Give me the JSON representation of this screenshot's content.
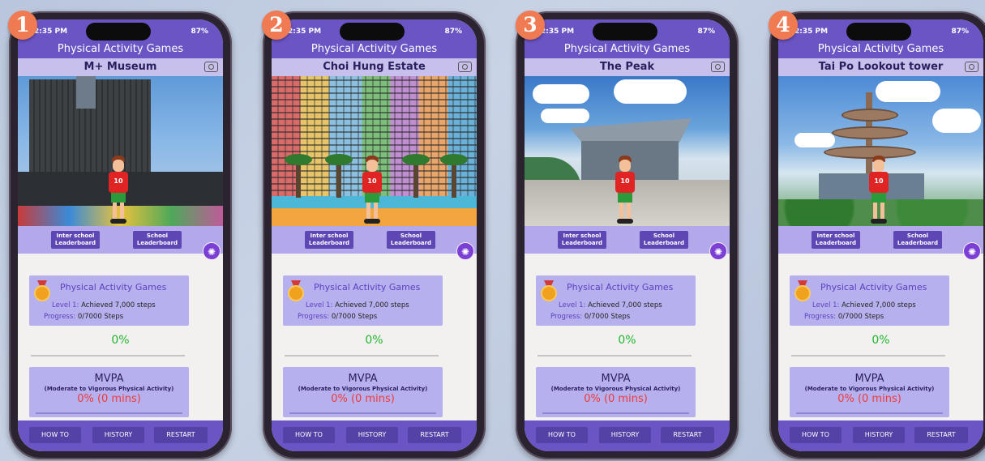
{
  "phones": [
    {
      "badge": "1",
      "status": {
        "time": "2:35 PM",
        "battery": "87%"
      },
      "app_title": "Physical Activity Games",
      "location": "M+ Museum",
      "jersey": "10",
      "inter_school": "Inter school\nLeaderboard",
      "school": "School\nLeaderboard",
      "card": {
        "title": "Physical Activity Games",
        "level_key": "Level 1:",
        "level_val": " Achieved 7,000 steps",
        "progress_key": "Progress:",
        "progress_val": " 0/7000 Steps"
      },
      "percent": "0%",
      "mvpa": {
        "title": "MVPA",
        "subtitle": "(Moderate to Vigorous Physical Activity)",
        "value": "0% (0 mins)"
      },
      "buttons": {
        "howto": "HOW TO",
        "history": "HISTORY",
        "restart": "RESTART"
      }
    },
    {
      "badge": "2",
      "status": {
        "time": "2:35 PM",
        "battery": "87%"
      },
      "app_title": "Physical Activity Games",
      "location": "Choi Hung Estate",
      "jersey": "10",
      "inter_school": "Inter school\nLeaderboard",
      "school": "School\nLeaderboard",
      "card": {
        "title": "Physical Activity Games",
        "level_key": "Level 1:",
        "level_val": " Achieved 7,000 steps",
        "progress_key": "Progress:",
        "progress_val": " 0/7000 Steps"
      },
      "percent": "0%",
      "mvpa": {
        "title": "MVPA",
        "subtitle": "(Moderate to Vigorous Physical Activity)",
        "value": "0% (0 mins)"
      },
      "buttons": {
        "howto": "HOW TO",
        "history": "HISTORY",
        "restart": "RESTART"
      }
    },
    {
      "badge": "3",
      "status": {
        "time": "2:35 PM",
        "battery": "87%"
      },
      "app_title": "Physical Activity Games",
      "location": "The Peak",
      "jersey": "10",
      "inter_school": "Inter school\nLeaderboard",
      "school": "School\nLeaderboard",
      "card": {
        "title": "Physical Activity Games",
        "level_key": "Level 1:",
        "level_val": " Achieved 7,000 steps",
        "progress_key": "Progress:",
        "progress_val": " 0/7000 Steps"
      },
      "percent": "0%",
      "mvpa": {
        "title": "MVPA",
        "subtitle": "(Moderate to Vigorous Physical Activity)",
        "value": "0% (0 mins)"
      },
      "buttons": {
        "howto": "HOW TO",
        "history": "HISTORY",
        "restart": "RESTART"
      }
    },
    {
      "badge": "4",
      "status": {
        "time": "2:35 PM",
        "battery": "87%"
      },
      "app_title": "Physical Activity Games",
      "location": "Tai Po Lookout tower",
      "jersey": "10",
      "inter_school": "Inter school\nLeaderboard",
      "school": "School\nLeaderboard",
      "card": {
        "title": "Physical Activity Games",
        "level_key": "Level 1:",
        "level_val": " Achieved 7,000 steps",
        "progress_key": "Progress:",
        "progress_val": " 0/7000 Steps"
      },
      "percent": "0%",
      "mvpa": {
        "title": "MVPA",
        "subtitle": "(Moderate to Vigorous Physical Activity)",
        "value": "0% (0 mins)"
      },
      "buttons": {
        "howto": "HOW TO",
        "history": "HISTORY",
        "restart": "RESTART"
      }
    }
  ],
  "colors": {
    "brand": "#6b54c4",
    "card": "#b7b0ee",
    "percent_green": "#1fb52f",
    "mvpa_red": "#ef3a3a",
    "badge": "#f07a52"
  },
  "icons": {
    "camera": "camera-icon",
    "medal": "medal-icon",
    "fab": "activity-fab-icon"
  },
  "progress": {
    "steps_fraction": 0,
    "mvpa_fraction": 0
  }
}
